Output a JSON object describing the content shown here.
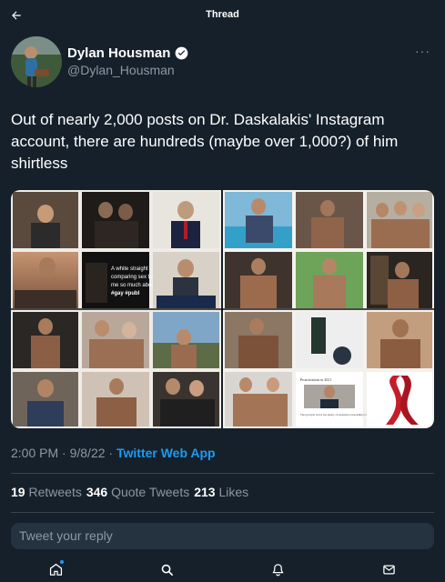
{
  "header": {
    "title": "Thread",
    "back_icon": "arrow-left-icon"
  },
  "author": {
    "display_name": "Dylan Housman",
    "handle": "@Dylan_Housman",
    "verified_icon": "verified-badge-icon",
    "more_label": "···"
  },
  "tweet": {
    "text": "Out of nearly 2,000 posts on Dr. Daskalakis' Instagram account, there are hundreds (maybe over 1,000?) of him shirtless",
    "media_text": {
      "quote_line1": "A white straight",
      "quote_line2": "comparing sex to b",
      "quote_line3": "me so much about.",
      "quote_tag": "#gay #publ",
      "doc_title": "Proactionism in 2021",
      "doc_caption": "The good-pal doctor has plenty of experience responding to the outbreak of a contagious disease"
    },
    "time": "2:00 PM",
    "date": "9/8/22",
    "source": "Twitter Web App",
    "separator": "·"
  },
  "stats": {
    "retweets_count": "19",
    "retweets_label": "Retweets",
    "quotes_count": "346",
    "quotes_label": "Quote Tweets",
    "likes_count": "213",
    "likes_label": "Likes"
  },
  "reply": {
    "placeholder": "Tweet your reply"
  },
  "nav": {
    "items": [
      {
        "name": "home-icon"
      },
      {
        "name": "search-icon"
      },
      {
        "name": "notifications-icon"
      },
      {
        "name": "messages-icon"
      }
    ]
  },
  "colors": {
    "background": "#15202b",
    "accent": "#1d9bf0",
    "secondary_text": "#8b98a5",
    "divider": "#38444d"
  }
}
